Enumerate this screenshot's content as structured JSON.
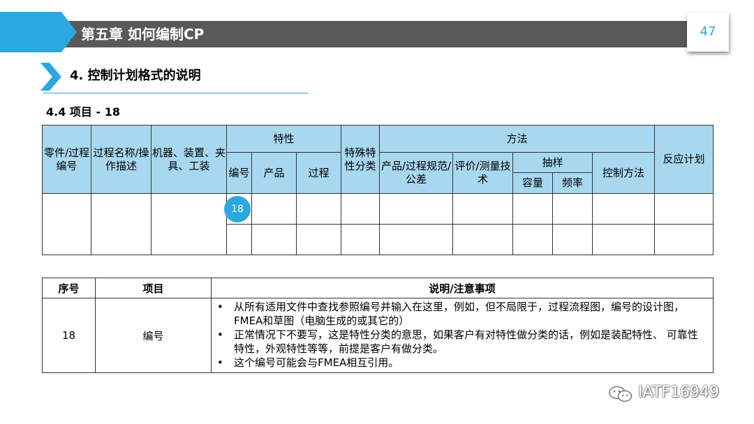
{
  "header": {
    "chapter_title": "第五章  如何编制CP",
    "page_number": "47",
    "accent_color": "#2ca8e0",
    "bar_color": "#595959"
  },
  "section": {
    "title": "4. 控制计划格式的说明",
    "subtitle": "4.4 项目 - 18"
  },
  "cp_table": {
    "part_no": "零件/过程编号",
    "process_name": "过程名称/操作描述",
    "machine": "机器、装置、夹具、工装",
    "characteristics": "特性",
    "char_no": "编号",
    "product": "产品",
    "process": "过程",
    "special_class": "特殊特性分类",
    "methods": "方法",
    "spec_tolerance": "产品/过程规范/公差",
    "eval_measure": "评价/测量技术",
    "sample": "抽样",
    "size": "容量",
    "freq": "频率",
    "control_method": "控制方法",
    "reaction_plan": "反应计划",
    "marker": "18"
  },
  "notes_table": {
    "col_seq": "序号",
    "col_item": "项目",
    "col_desc": "说明/注意事项",
    "seq": "18",
    "item": "编号",
    "bullets": [
      "从所有适用文件中查找参照编号并输入在这里，例如，但不局限于，过程流程图，编号的设计图，FMEA和草图（电脑生成的或其它的）",
      "正常情况下不要写，这是特性分类的意思，如果客户有对特性做分类的话，例如是装配特性、 可靠性特性，外观特性等等，前提是客户有做分类。",
      "这个编号可能会与FMEA相互引用。"
    ]
  },
  "watermark": {
    "icon": "wechat-icon",
    "text": "IATF16949"
  }
}
